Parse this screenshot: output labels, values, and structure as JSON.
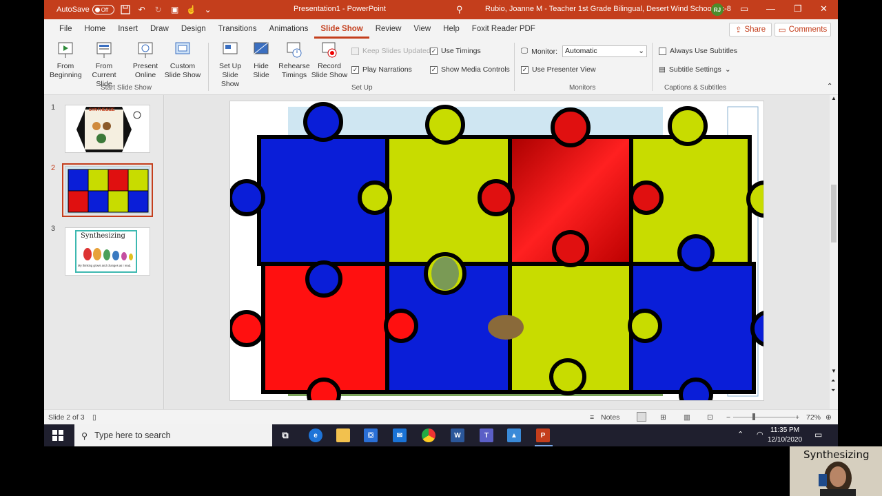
{
  "titlebar": {
    "autosave_label": "AutoSave",
    "autosave_state": "Off",
    "doc_title": "Presentation1 - PowerPoint",
    "user": "Rubio, Joanne M - Teacher 1st Grade Bilingual, Desert Wind School Pk-8",
    "initials": "RJ"
  },
  "menu": {
    "tabs": [
      "File",
      "Home",
      "Insert",
      "Draw",
      "Design",
      "Transitions",
      "Animations",
      "Slide Show",
      "Review",
      "View",
      "Help",
      "Foxit Reader PDF"
    ],
    "active_tab": "Slide Show",
    "share": "Share",
    "comments": "Comments"
  },
  "ribbon": {
    "from_beginning": "From Beginning",
    "from_current": "From Current Slide",
    "present_online": "Present Online",
    "custom_show": "Custom Slide Show",
    "start_group": "Start Slide Show",
    "setup_show": "Set Up Slide Show",
    "hide_slide": "Hide Slide",
    "rehearse": "Rehearse Timings",
    "record": "Record Slide Show",
    "keep_updated": "Keep Slides Updated",
    "play_narrations": "Play Narrations",
    "use_timings": "Use Timings",
    "show_media": "Show Media Controls",
    "setup_group": "Set Up",
    "monitor_label": "Monitor:",
    "monitor_value": "Automatic",
    "presenter_view": "Use Presenter View",
    "monitors_group": "Monitors",
    "always_subtitles": "Always Use Subtitles",
    "subtitle_settings": "Subtitle Settings",
    "captions_group": "Captions & Subtitles"
  },
  "slides": {
    "numbers": [
      "1",
      "2",
      "3"
    ],
    "thumb1_title": "SYNTHESIZE",
    "thumb3_title": "Synthesizing",
    "thumb3_caption": "My thinking grows and changes as I read.",
    "selected": 2
  },
  "status": {
    "slide_info": "Slide 2 of 3",
    "notes": "Notes",
    "zoom": "72%"
  },
  "taskbar": {
    "search_placeholder": "Type here to search",
    "time": "11:35 PM",
    "date": "12/10/2020"
  },
  "webcam": {
    "overlay_text": "Synthesizing"
  },
  "colors": {
    "accent": "#c43e1c",
    "puzzle_blue": "#0a1ed8",
    "puzzle_yellow": "#c8dc00",
    "puzzle_red": "#e01010"
  }
}
